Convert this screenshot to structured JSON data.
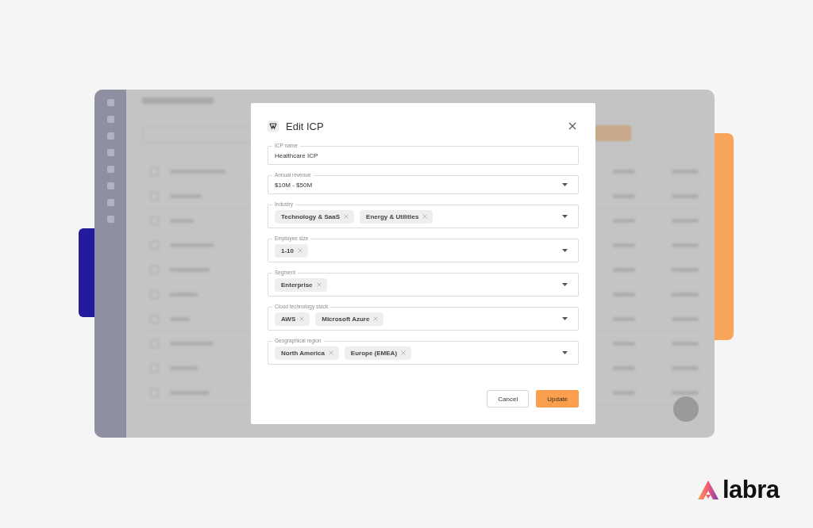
{
  "dialog": {
    "title": "Edit ICP",
    "fields": [
      {
        "kind": "text",
        "label": "ICP name",
        "value": "Healthcare ICP"
      },
      {
        "kind": "select",
        "label": "Annual revenue",
        "value": "$10M - $50M"
      },
      {
        "kind": "multiselect",
        "label": "Industry",
        "chips": [
          "Technology & SaaS",
          "Energy & Utilities"
        ]
      },
      {
        "kind": "multiselect",
        "label": "Employee size",
        "chips": [
          "1-10"
        ]
      },
      {
        "kind": "multiselect",
        "label": "Segment",
        "chips": [
          "Enterprise"
        ]
      },
      {
        "kind": "multiselect",
        "label": "Cloud technology stack",
        "chips": [
          "AWS",
          "Microsoft Azure"
        ]
      },
      {
        "kind": "multiselect",
        "label": "Geographical region",
        "chips": [
          "North America",
          "Europe (EMEA)"
        ]
      }
    ],
    "buttons": [
      {
        "kind": "secondary",
        "label": "Cancel"
      },
      {
        "kind": "primary",
        "label": "Update"
      }
    ]
  },
  "brand": {
    "name": "labra"
  }
}
